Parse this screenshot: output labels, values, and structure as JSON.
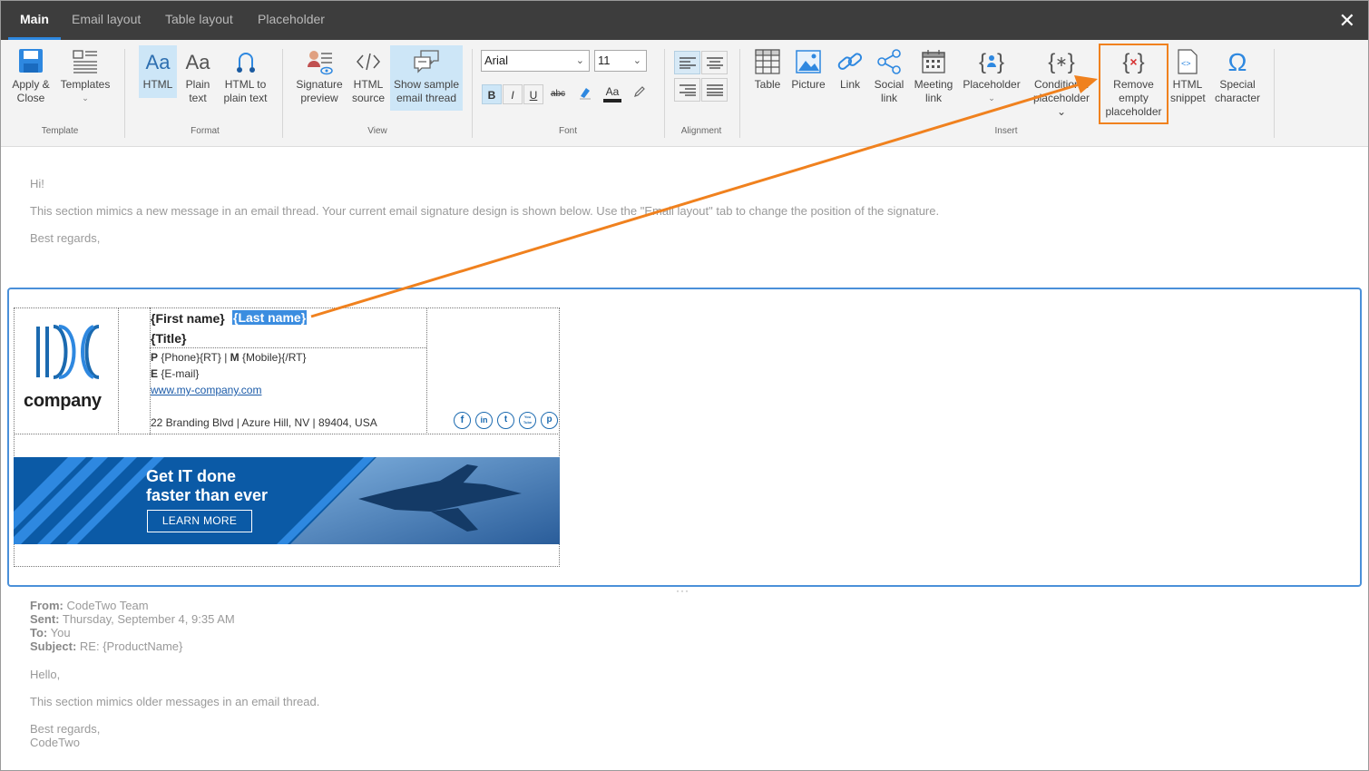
{
  "tabs": [
    {
      "label": "Main",
      "active": true
    },
    {
      "label": "Email layout"
    },
    {
      "label": "Table layout"
    },
    {
      "label": "Placeholder"
    }
  ],
  "ribbon": {
    "template": {
      "group": "Template",
      "apply_close": [
        "Apply &",
        "Close"
      ],
      "templates": "Templates"
    },
    "format": {
      "group": "Format",
      "html": "HTML",
      "plain_text": [
        "Plain",
        "text"
      ],
      "html_to_plain": [
        "HTML to",
        "plain text"
      ]
    },
    "view": {
      "group": "View",
      "signature_preview": [
        "Signature",
        "preview"
      ],
      "html_source": [
        "HTML",
        "source"
      ],
      "show_sample": [
        "Show sample",
        "email thread"
      ]
    },
    "font": {
      "group": "Font",
      "family": "Arial",
      "size": "11"
    },
    "alignment": {
      "group": "Alignment"
    },
    "insert": {
      "group": "Insert",
      "table": "Table",
      "picture": "Picture",
      "link": "Link",
      "social_link": [
        "Social",
        "link"
      ],
      "meeting_link": [
        "Meeting",
        "link"
      ],
      "placeholder": "Placeholder",
      "conditional": [
        "Conditional",
        "placeholder"
      ],
      "remove_empty": [
        "Remove",
        "empty",
        "placeholder"
      ],
      "html_snippet": [
        "HTML",
        "snippet"
      ],
      "special_char": [
        "Special",
        "character"
      ]
    }
  },
  "new_message": {
    "greeting": "Hi!",
    "body": "This section mimics a new message in an email thread. Your current email signature design is shown below. Use the \"Email layout\" tab to change the position of the signature.",
    "closing": "Best regards,"
  },
  "signature": {
    "logo_text": "company",
    "first_name": "{First name}",
    "last_name": "{Last name}",
    "title": "{Title}",
    "phone_label": "P",
    "phone": "{Phone}{RT} | ",
    "mobile_label": "M",
    "mobile": "{Mobile}{/RT}",
    "email_label": "E",
    "email": "{E-mail}",
    "website": "www.my-company.com",
    "address": "22 Branding Blvd | Azure Hill, NV | 89404, USA",
    "banner_line1": "Get IT done",
    "banner_line2": "faster than ever",
    "banner_button": "LEARN MORE",
    "social": [
      "f",
      "in",
      "t",
      "You Tube",
      "p"
    ]
  },
  "older_message": {
    "from_label": "From:",
    "from": "CodeTwo Team",
    "sent_label": "Sent:",
    "sent": "Thursday, September 4, 9:35 AM",
    "to_label": "To:",
    "to": "You",
    "subject_label": "Subject:",
    "subject": "RE: {ProductName}",
    "greeting": "Hello,",
    "body": "This section mimics older messages in an email thread.",
    "closing": "Best regards,",
    "signoff": "CodeTwo"
  },
  "colors": {
    "accent": "#2e88e0",
    "highlight_callout": "#f0811e",
    "selection": "#3b8de0"
  }
}
